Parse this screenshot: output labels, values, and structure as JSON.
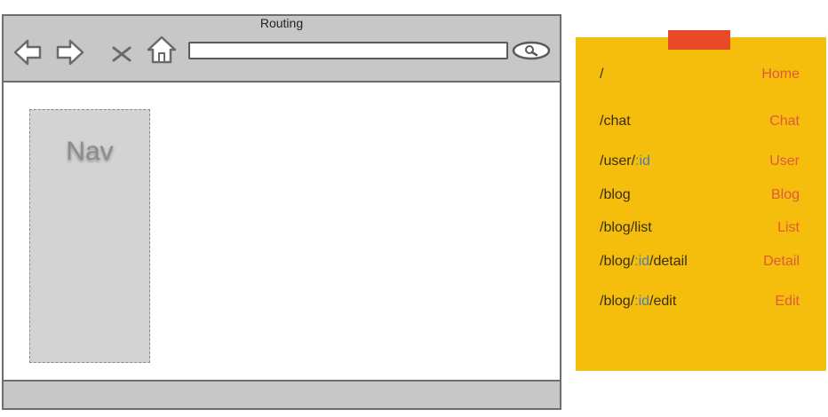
{
  "browser": {
    "title": "Routing",
    "nav_panel_label": "Nav"
  },
  "colors": {
    "note": "#f5bd0c",
    "tape": "#e84a27",
    "route_name": "#e05a3a",
    "param": "#4a7fb0",
    "toolbar": "#c7c7c7",
    "nav_panel": "#d3d3d3"
  },
  "routes": [
    {
      "path_parts": [
        "/"
      ],
      "name": "Home"
    },
    {
      "path_parts": [
        "/chat"
      ],
      "name": "Chat"
    },
    {
      "path_parts": [
        "/user/",
        ":id"
      ],
      "name": "User"
    },
    {
      "path_parts": [
        "/blog"
      ],
      "name": "Blog"
    },
    {
      "path_parts": [
        "/blog/list"
      ],
      "name": "List"
    },
    {
      "path_parts": [
        "/blog/",
        ":id",
        "/detail"
      ],
      "name": "Detail"
    },
    {
      "path_parts": [
        "/blog/",
        ":id",
        "/edit"
      ],
      "name": "Edit"
    }
  ]
}
